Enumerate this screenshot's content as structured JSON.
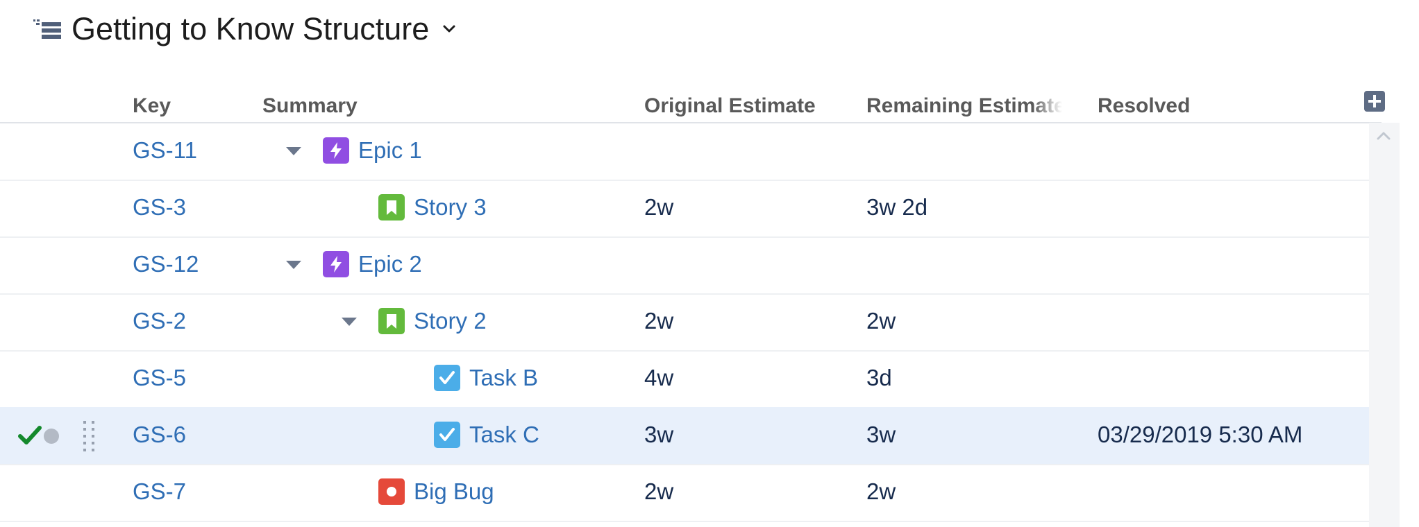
{
  "structure": {
    "title": "Getting to Know Structure",
    "icon": "structure-list-icon",
    "dropdown_icon": "chevron-down-icon"
  },
  "columns": {
    "key": "Key",
    "summary": "Summary",
    "original_estimate": "Original Estimate",
    "remaining_estimate": "Remaining Estimate",
    "resolved": "Resolved",
    "add_column_icon": "plus-icon"
  },
  "rows": [
    {
      "key": "GS-11",
      "summary": "Epic 1",
      "type": "epic",
      "expandable": true,
      "original_estimate": "",
      "remaining_estimate": "",
      "resolved": ""
    },
    {
      "key": "GS-3",
      "summary": "Story 3",
      "type": "story",
      "expandable": false,
      "original_estimate": "2w",
      "remaining_estimate": "3w 2d",
      "resolved": ""
    },
    {
      "key": "GS-12",
      "summary": "Epic 2",
      "type": "epic",
      "expandable": true,
      "original_estimate": "",
      "remaining_estimate": "",
      "resolved": ""
    },
    {
      "key": "GS-2",
      "summary": "Story 2",
      "type": "story",
      "expandable": true,
      "original_estimate": "2w",
      "remaining_estimate": "2w",
      "resolved": ""
    },
    {
      "key": "GS-5",
      "summary": "Task B",
      "type": "task",
      "expandable": false,
      "original_estimate": "4w",
      "remaining_estimate": "3d",
      "resolved": ""
    },
    {
      "key": "GS-6",
      "summary": "Task C",
      "type": "task",
      "expandable": false,
      "original_estimate": "3w",
      "remaining_estimate": "3w",
      "resolved": "03/29/2019 5:30 AM",
      "selected": true
    },
    {
      "key": "GS-7",
      "summary": "Big Bug",
      "type": "bug",
      "expandable": false,
      "original_estimate": "2w",
      "remaining_estimate": "2w",
      "resolved": ""
    }
  ],
  "colors": {
    "link": "#2f6eb5",
    "epic": "#904ee2",
    "story": "#63ba3c",
    "task": "#4bade8",
    "bug": "#e5493a",
    "selected_row": "#e8f0fb",
    "resolved_check": "#14892c"
  }
}
